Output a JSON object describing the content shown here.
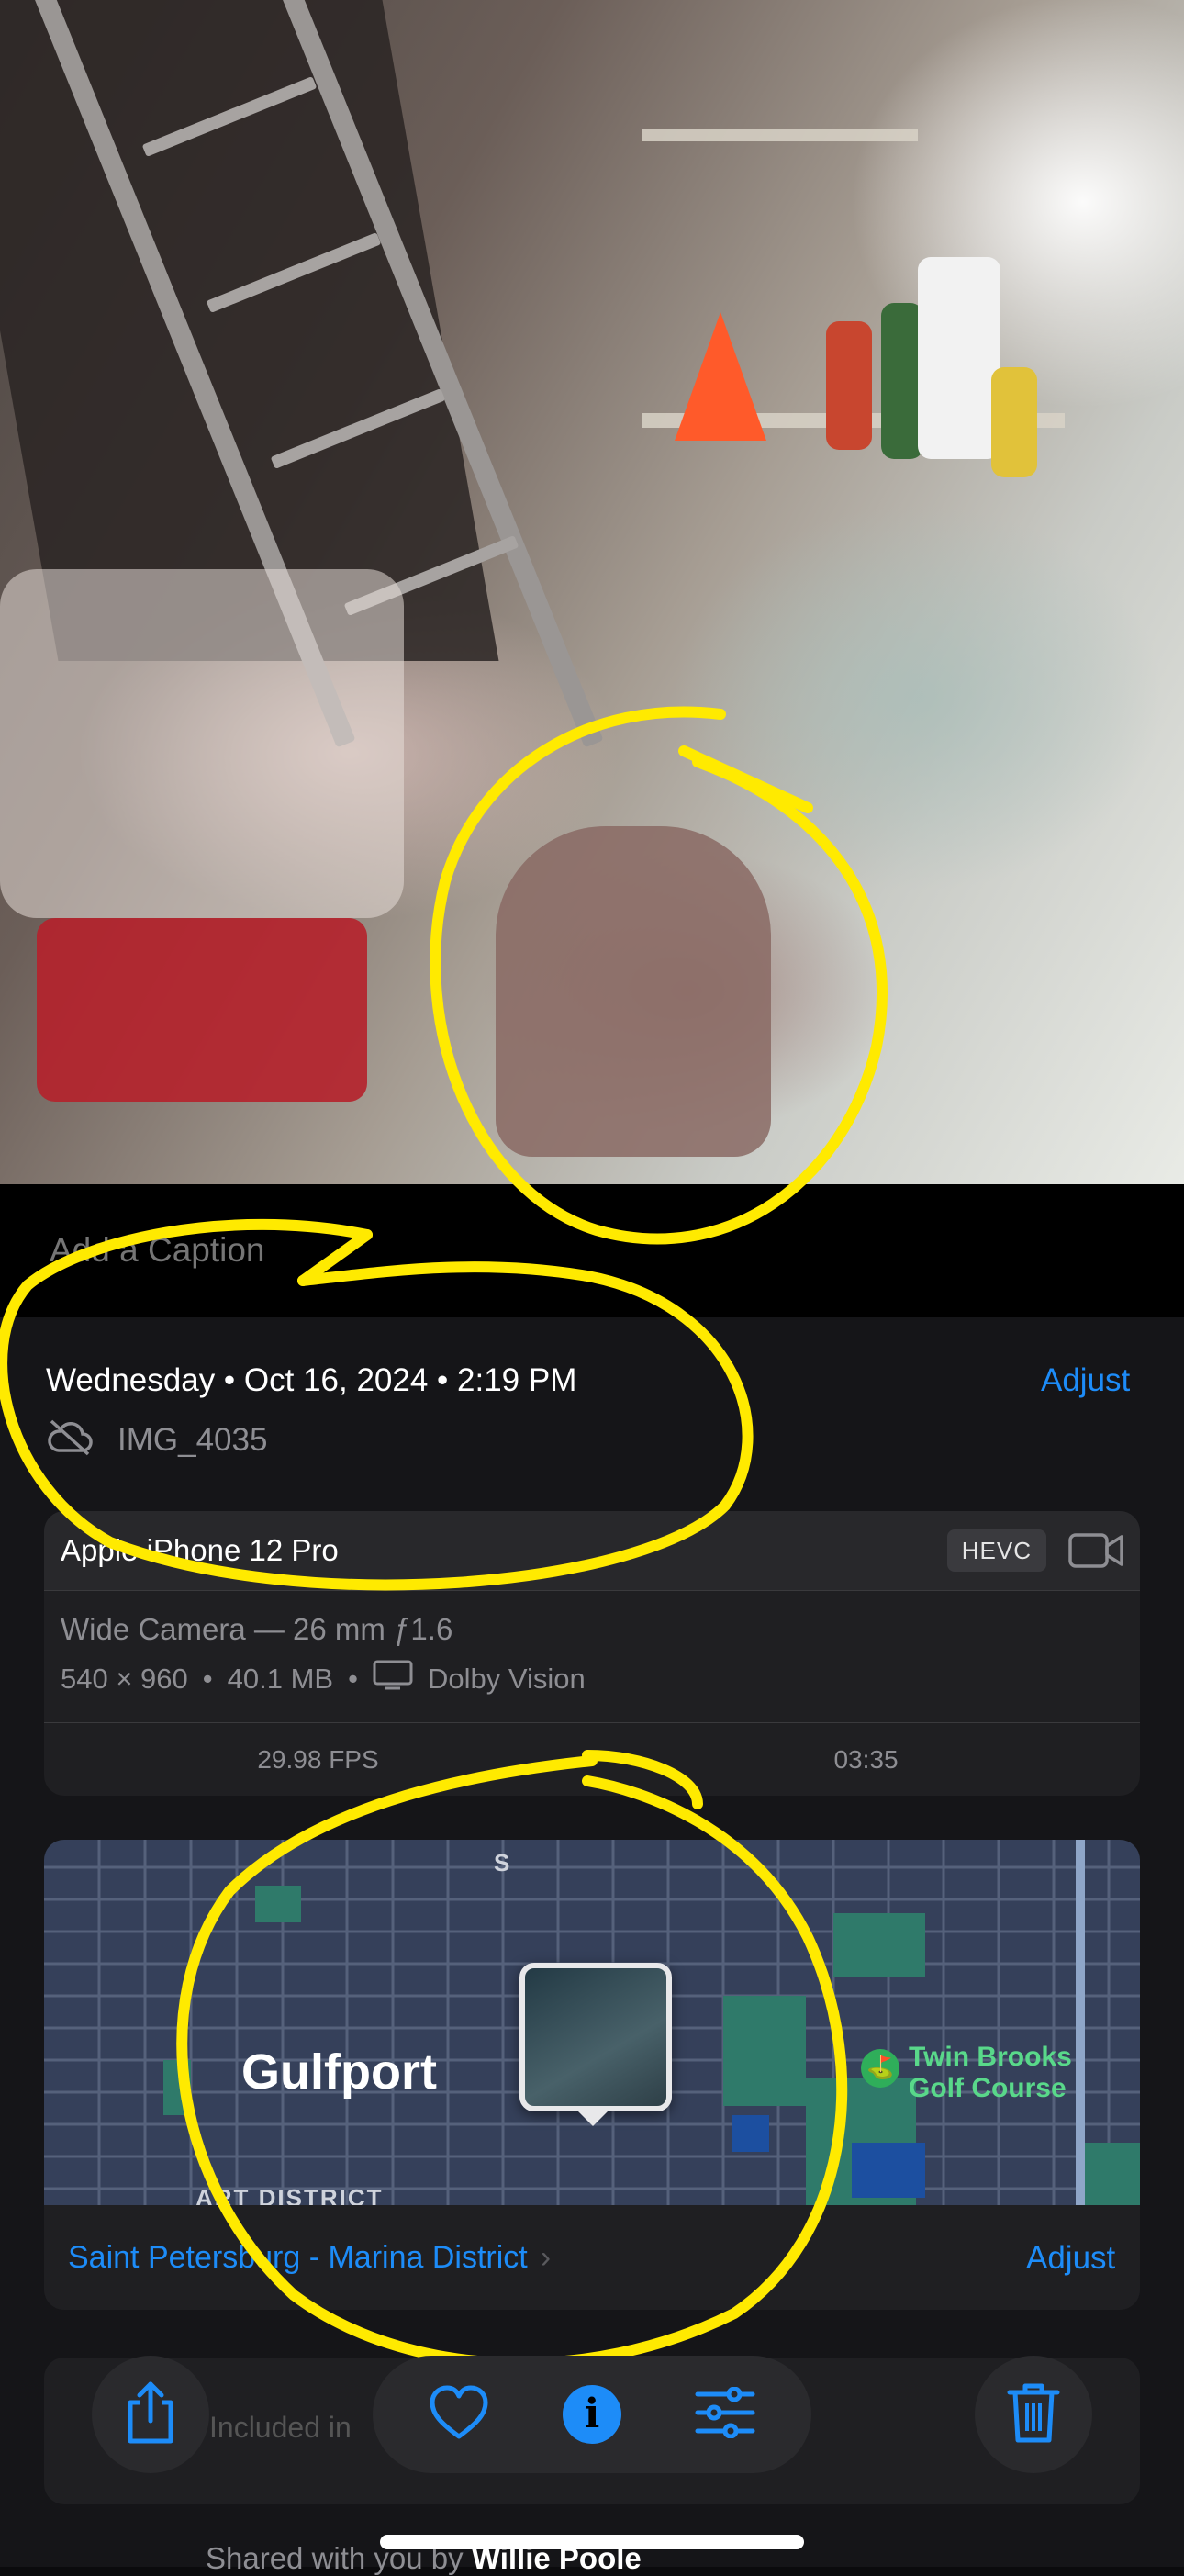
{
  "caption": {
    "placeholder": "Add a Caption"
  },
  "metadata": {
    "datetime": "Wednesday • Oct 16, 2024 • 2:19 PM",
    "adjust_label": "Adjust",
    "filename": "IMG_4035",
    "cloud_status_icon": "cloud-slash-icon"
  },
  "device": {
    "name": "Apple iPhone 12 Pro",
    "format_badge": "HEVC",
    "media_icon": "video-camera-icon",
    "lens": "Wide Camera — 26 mm ƒ1.6",
    "resolution": "540 × 960",
    "file_size": "40.1 MB",
    "display_icon": "display-icon",
    "hdr": "Dolby Vision",
    "fps": "29.98 FPS",
    "duration": "03:35"
  },
  "map": {
    "city": "Gulfport",
    "district": "ART DISTRICT",
    "street_label": "S",
    "poi_line1": "Twin Brooks",
    "poi_line2": "Golf Course",
    "location": "Saint Petersburg - Marina District",
    "adjust_label": "Adjust"
  },
  "shared": {
    "text": "Included in",
    "shared_by_prefix": "Shared with you by",
    "shared_by_name": "Willie Poole"
  },
  "toolbar": {
    "share": "share-icon",
    "favorite": "heart-icon",
    "info": "info-icon",
    "info_glyph": "i",
    "edit": "sliders-icon",
    "delete": "trash-icon"
  },
  "colors": {
    "accent": "#1d8cf8",
    "markup": "#ffea00",
    "background": "#151518"
  }
}
